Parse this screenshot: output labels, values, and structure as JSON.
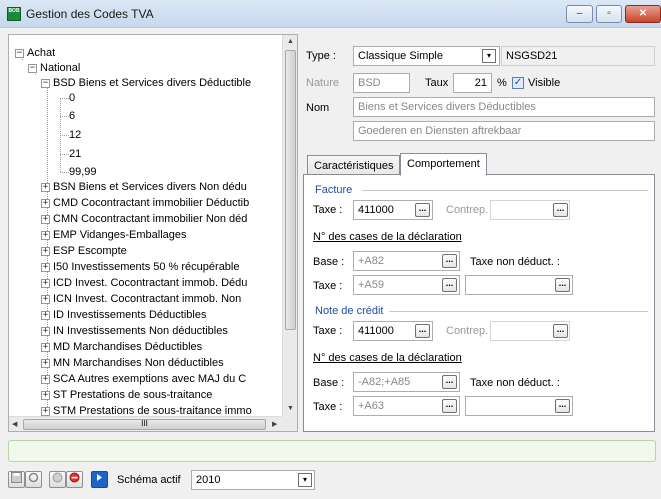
{
  "window": {
    "title": "Gestion des Codes TVA",
    "icon_text": "BOB"
  },
  "tree": {
    "root": "Achat",
    "group": "National",
    "expanded": "BSD Biens et Services divers Déductible",
    "rates": [
      "0",
      "6",
      "12",
      "21",
      "99,99"
    ],
    "items": [
      "BSN Biens et Services divers Non dédu",
      "CMD Cocontractant immobilier Déductib",
      "CMN Cocontractant immobilier Non déd",
      "EMP Vidanges-Emballages",
      "ESP Escompte",
      "I50 Investissements 50 % récupérable",
      "ICD Invest. Cocontractant immob. Dédu",
      "ICN Invest. Cocontractant immob. Non",
      "ID Investissements Déductibles",
      "IN Investissements Non déductibles",
      "MD Marchandises Déductibles",
      "MN Marchandises Non déductibles",
      "SCA Autres exemptions avec MAJ du C",
      "ST Prestations de sous-traitance",
      "STM Prestations de sous-traitance immo"
    ],
    "hscroll_grip": "III"
  },
  "form": {
    "type_label": "Type :",
    "type_value": "Classique Simple",
    "code": "NSGSD21",
    "nature_label": "Nature",
    "nature_value": "BSD",
    "taux_label": "Taux",
    "taux_value": "21",
    "percent": "%",
    "visible_label": "Visible",
    "nom_label": "Nom",
    "nom_fr": "Biens et Services divers Déductibles",
    "nom_nl": "Goederen en Diensten aftrekbaar"
  },
  "tabs": [
    "Caractéristiques",
    "Comportement"
  ],
  "facture": {
    "title": "Facture",
    "taxe_label": "Taxe :",
    "taxe_value": "411000",
    "contrep_label": "Contrep.",
    "cases_title": "N° des cases de la déclaration",
    "base_label": "Base :",
    "base_value": "+A82",
    "taxe_non_label": "Taxe non déduct. :",
    "taxe2_label": "Taxe :",
    "taxe2_value": "+A59"
  },
  "credit": {
    "title": "Note de crédit",
    "taxe_label": "Taxe :",
    "taxe_value": "411000",
    "contrep_label": "Contrep.",
    "cases_title": "N° des cases de la déclaration",
    "base_label": "Base :",
    "base_value": "-A82;+A85",
    "taxe_non_label": "Taxe non déduct. :",
    "taxe2_label": "Taxe :",
    "taxe2_value": "+A63"
  },
  "bottom": {
    "schema_label": "Schéma actif",
    "schema_value": "2010"
  },
  "glyphs": {
    "ellipsis": "...",
    "combo": "▾",
    "check": "✓",
    "minus": "−",
    "plus": "+",
    "min": "–",
    "max": "▫",
    "close": "✕",
    "up": "▲",
    "down": "▼",
    "left": "◀",
    "right": "▶"
  }
}
